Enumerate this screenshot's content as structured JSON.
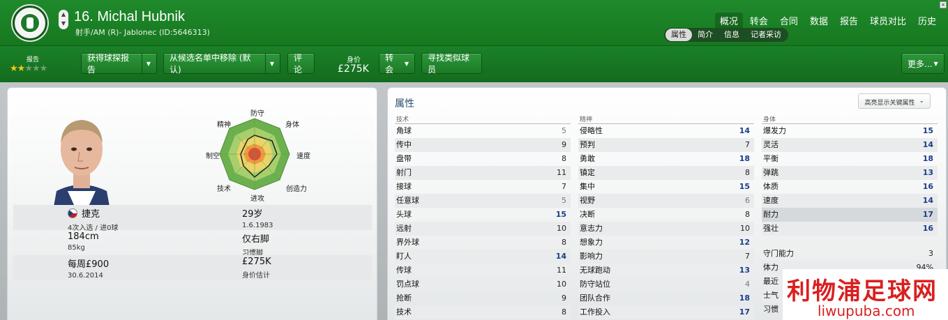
{
  "header": {
    "player_title": "16. Michal Hubnik",
    "subtitle": "射手/AM (R)- Jablonec (ID:5646313)",
    "nav_tabs": [
      "概况",
      "转会",
      "合同",
      "数据",
      "报告",
      "球员对比",
      "历史"
    ],
    "sub_tabs": [
      "属性",
      "简介",
      "信息",
      "记者采访"
    ]
  },
  "action_bar": {
    "report_label": "报告",
    "stars_filled": 2,
    "stars_total": 5,
    "get_scout_report": "获得球探报告",
    "remove_from_shortlist": "从候选名单中移除 (默认)",
    "comment": "评论",
    "value_label": "身价",
    "value": "£275K",
    "transfer": "转会",
    "find_similar": "寻找类似球员",
    "more": "更多..."
  },
  "radar": {
    "labels": [
      "防守",
      "身体",
      "速度",
      "创造力",
      "进攻",
      "技术",
      "制空",
      "精神"
    ]
  },
  "profile": {
    "nationality": "捷克",
    "caps": "4次入选 / 进0球",
    "age": "29岁",
    "dob": "1.6.1983",
    "height": "184cm",
    "weight": "85kg",
    "foot": "仅右脚",
    "foot_label": "习惯脚",
    "wage": "每周£900",
    "contract_end": "30.6.2014",
    "value": "£275K",
    "value_label": "身价估计"
  },
  "attributes": {
    "title": "属性",
    "highlight_btn": "高亮显示关键属性",
    "technical_header": "技术",
    "mental_header": "精神",
    "physical_header": "身体",
    "technical": [
      {
        "name": "角球",
        "value": "5",
        "level": "lo"
      },
      {
        "name": "传中",
        "value": "9",
        "level": "mid"
      },
      {
        "name": "盘带",
        "value": "8",
        "level": "mid"
      },
      {
        "name": "射门",
        "value": "11",
        "level": "mid"
      },
      {
        "name": "接球",
        "value": "7",
        "level": "mid"
      },
      {
        "name": "任意球",
        "value": "5",
        "level": "lo"
      },
      {
        "name": "头球",
        "value": "15",
        "level": "hi"
      },
      {
        "name": "远射",
        "value": "10",
        "level": "mid"
      },
      {
        "name": "界外球",
        "value": "8",
        "level": "mid"
      },
      {
        "name": "盯人",
        "value": "14",
        "level": "hi"
      },
      {
        "name": "传球",
        "value": "11",
        "level": "mid"
      },
      {
        "name": "罚点球",
        "value": "10",
        "level": "mid"
      },
      {
        "name": "抢断",
        "value": "9",
        "level": "mid"
      },
      {
        "name": "技术",
        "value": "8",
        "level": "mid"
      }
    ],
    "mental": [
      {
        "name": "侵略性",
        "value": "14",
        "level": "hi"
      },
      {
        "name": "预判",
        "value": "7",
        "level": "mid"
      },
      {
        "name": "勇敢",
        "value": "18",
        "level": "hi"
      },
      {
        "name": "镇定",
        "value": "8",
        "level": "mid"
      },
      {
        "name": "集中",
        "value": "15",
        "level": "hi"
      },
      {
        "name": "视野",
        "value": "6",
        "level": "lo"
      },
      {
        "name": "决断",
        "value": "8",
        "level": "mid"
      },
      {
        "name": "意志力",
        "value": "10",
        "level": "mid"
      },
      {
        "name": "想象力",
        "value": "12",
        "level": "hi"
      },
      {
        "name": "影响力",
        "value": "7",
        "level": "mid"
      },
      {
        "name": "无球跑动",
        "value": "13",
        "level": "hi"
      },
      {
        "name": "防守站位",
        "value": "4",
        "level": "lo"
      },
      {
        "name": "团队合作",
        "value": "18",
        "level": "hi"
      },
      {
        "name": "工作投入",
        "value": "17",
        "level": "hi"
      }
    ],
    "physical": [
      {
        "name": "爆发力",
        "value": "15",
        "level": "hi"
      },
      {
        "name": "灵活",
        "value": "14",
        "level": "hi"
      },
      {
        "name": "平衡",
        "value": "18",
        "level": "hi"
      },
      {
        "name": "弹跳",
        "value": "13",
        "level": "hi"
      },
      {
        "name": "体质",
        "value": "16",
        "level": "hi"
      },
      {
        "name": "速度",
        "value": "14",
        "level": "hi"
      },
      {
        "name": "耐力",
        "value": "17",
        "level": "hi"
      },
      {
        "name": "强壮",
        "value": "16",
        "level": "hi"
      }
    ],
    "other": [
      {
        "name": "守门能力",
        "value": "3"
      },
      {
        "name": "体力",
        "value": "94%"
      },
      {
        "name": "最近",
        "value": ""
      },
      {
        "name": "士气",
        "value": ""
      },
      {
        "name": "习惯",
        "value": ""
      }
    ]
  },
  "watermark": {
    "line1": "利物浦足球网",
    "line2": "liwupuba.com"
  }
}
